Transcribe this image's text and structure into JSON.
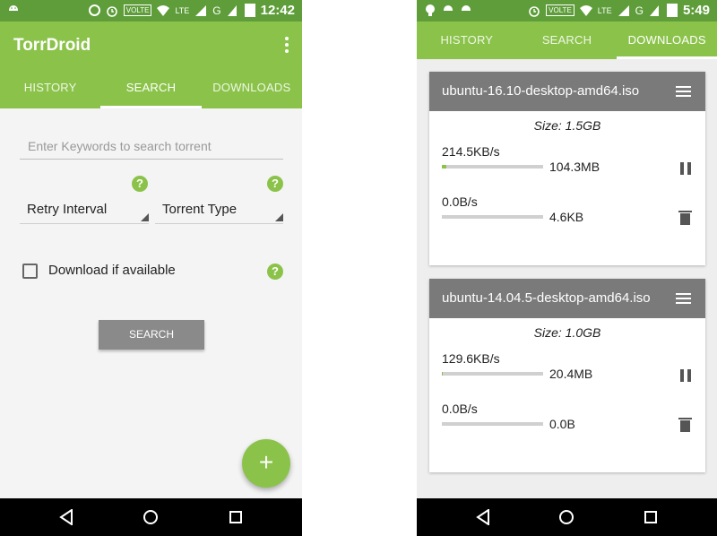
{
  "left": {
    "status": {
      "time": "12:42",
      "volte": "VOLTE",
      "network": "LTE",
      "g": "G"
    },
    "app_title": "TorrDroid",
    "tabs": [
      {
        "label": "HISTORY"
      },
      {
        "label": "SEARCH"
      },
      {
        "label": "DOWNLOADS"
      }
    ],
    "search": {
      "placeholder": "Enter Keywords to search torrent"
    },
    "retry_interval": "Retry Interval",
    "torrent_type": "Torrent Type",
    "download_if_available": "Download if available",
    "search_button": "SEARCH",
    "help_glyph": "?",
    "fab_glyph": "+"
  },
  "right": {
    "status": {
      "time": "5:49",
      "volte": "VOLTE",
      "network": "LTE",
      "g": "G"
    },
    "tabs": [
      {
        "label": "HISTORY"
      },
      {
        "label": "SEARCH"
      },
      {
        "label": "DOWNLOADS"
      }
    ],
    "downloads": [
      {
        "name": "ubuntu-16.10-desktop-amd64.iso",
        "size": "Size: 1.5GB",
        "down_speed": "214.5KB/s",
        "down_amount": "104.3MB",
        "down_progress": 0.04,
        "up_speed": "0.0B/s",
        "up_amount": "4.6KB",
        "up_progress": 0
      },
      {
        "name": "ubuntu-14.04.5-desktop-amd64.iso",
        "size": "Size: 1.0GB",
        "down_speed": "129.6KB/s",
        "down_amount": "20.4MB",
        "down_progress": 0.01,
        "up_speed": "0.0B/s",
        "up_amount": "0.0B",
        "up_progress": 0
      }
    ]
  },
  "colors": {
    "accent": "#8bc34a",
    "statusbar": "#5e9d3a",
    "card_header": "#7a7a7a"
  }
}
